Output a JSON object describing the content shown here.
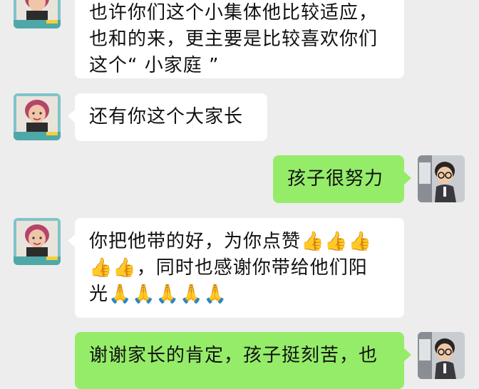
{
  "messages": [
    {
      "side": "incoming",
      "sender": "parent",
      "lines": [
        "也许你们这个小集体他比较适应，",
        "也和的来，更主要是比较喜欢你们",
        "这个“ 小家庭 ”"
      ]
    },
    {
      "side": "incoming",
      "sender": "parent",
      "lines": [
        "还有你这个大家长"
      ]
    },
    {
      "side": "outgoing",
      "sender": "teacher",
      "lines": [
        "孩子很努力"
      ]
    },
    {
      "side": "incoming",
      "sender": "parent",
      "lines": [
        "你把他带的好，为你点赞👍👍👍",
        "👍👍，同时也感谢你带给他们阳",
        "光🙏🙏🙏🙏🙏"
      ]
    },
    {
      "side": "outgoing",
      "sender": "teacher",
      "lines": [
        "谢谢家长的肯定，孩子挺刻苦，也"
      ]
    }
  ],
  "colors": {
    "background": "#ededed",
    "incoming_bubble": "#ffffff",
    "outgoing_bubble": "#95ec69",
    "text": "#111111"
  },
  "icons": {
    "parent_avatar": "woman-portrait-avatar",
    "teacher_avatar": "child-with-glasses-avatar"
  }
}
